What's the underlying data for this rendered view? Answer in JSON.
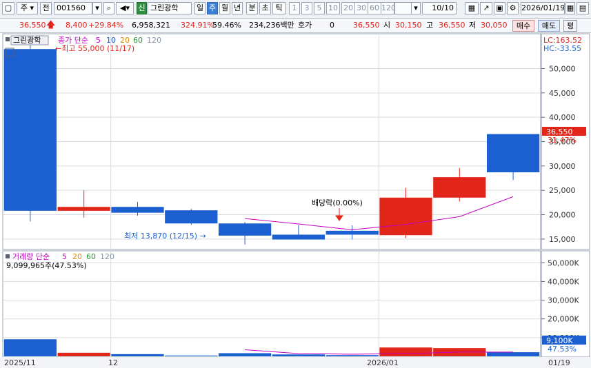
{
  "toolbar": {
    "market": "주",
    "prev_label": "전",
    "code": "001560",
    "badge": "신",
    "name": "그린광학",
    "periods": [
      "일",
      "주",
      "월",
      "년",
      "분",
      "초",
      "틱"
    ],
    "selected_period": "주",
    "intervals": [
      "1",
      "3",
      "5",
      "10",
      "20",
      "30",
      "60",
      "120"
    ],
    "count": "10/10",
    "date": "2026/01/19"
  },
  "info": {
    "price": "36,550",
    "change": "8,400",
    "change_pct": "+29.84%",
    "volume": "6,958,321",
    "volume_ratio": "324.91%",
    "turnover_ratio": "59.46%",
    "amount": "234,236백만",
    "quote_label": "호가",
    "quote_value": "0",
    "current": "36,550",
    "open_label": "시",
    "open": "30,150",
    "high_label": "고",
    "high": "36,550",
    "low_label": "저",
    "low": "30,050",
    "buy_label": "매수",
    "sell_label": "매도",
    "eval_label": "평"
  },
  "price_panel": {
    "stock_label": "그린광학",
    "legend": {
      "base": "종가 단순",
      "ma": [
        "5",
        "10",
        "20",
        "60",
        "120"
      ]
    },
    "lc": "LC:163.52",
    "hc": "HC:-33.55",
    "max_note": "최고 55,000 (11/17)",
    "min_note": "최저 13,870 (12/15)",
    "dividend_note": "배당락(0.00%)",
    "current_price_tag": "36,550",
    "current_pct_tag": "31.47%",
    "y_ticks": [
      "50,000",
      "45,000",
      "40,000",
      "35,000",
      "30,000",
      "25,000",
      "20,000",
      "15,000"
    ]
  },
  "volume_panel": {
    "legend": {
      "base": "거래량 단순",
      "ma": [
        "5",
        "20",
        "60",
        "120"
      ]
    },
    "max_note": "9,099,965주(47.53%)",
    "current_tag": "9,100K",
    "current_pct": "47.53%",
    "y_ticks": [
      "50,000K",
      "40,000K",
      "30,000K",
      "20,000K",
      "10,000K"
    ]
  },
  "x_labels": [
    "2025/11",
    "12",
    "2026/01",
    "01/19"
  ],
  "colors": {
    "up": "#e3261a",
    "down": "#1b5fd1",
    "ma5": "#c400c4",
    "grid": "#d9dde3"
  },
  "chart_data": {
    "type": "candlestick",
    "x": [
      "2025-11-17",
      "2025-11-24",
      "2025-12-01",
      "2025-12-08",
      "2025-12-15",
      "2025-12-22",
      "2025-12-29",
      "2026-01-05",
      "2026-01-12",
      "2026-01-19"
    ],
    "open": [
      54000,
      20800,
      21600,
      20900,
      18200,
      15900,
      16700,
      15800,
      23500,
      36550
    ],
    "high": [
      55000,
      25000,
      22600,
      21200,
      18500,
      17900,
      17800,
      25500,
      29600,
      36550
    ],
    "low": [
      18600,
      19400,
      19800,
      17900,
      13870,
      15500,
      14900,
      15200,
      22700,
      27100
    ],
    "close": [
      20800,
      21600,
      20400,
      18200,
      15700,
      14900,
      15900,
      23500,
      27700,
      28700
    ],
    "ma5": [
      null,
      null,
      null,
      null,
      19200,
      18100,
      16900,
      18000,
      19600,
      23700
    ],
    "volume": [
      9099965,
      1909000,
      1150000,
      384000,
      1670000,
      1007000,
      648000,
      4700000,
      4380000,
      2170000
    ],
    "volume_ma5": [
      null,
      null,
      null,
      null,
      3500000,
      1490000,
      1100000,
      1450000,
      2250000,
      2260000
    ],
    "price_ylim": [
      13000,
      57000
    ],
    "volume_ylim": [
      0,
      56000000
    ]
  }
}
